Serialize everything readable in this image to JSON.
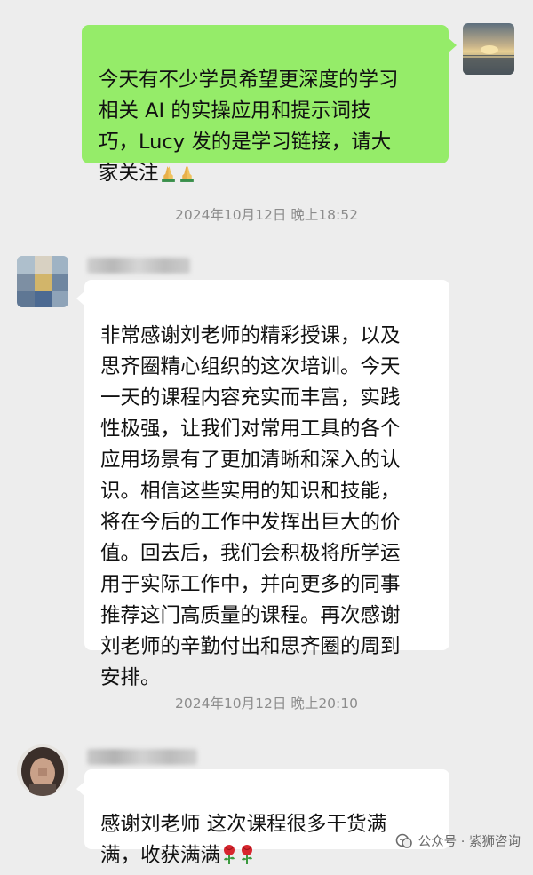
{
  "messages": [
    {
      "side": "right",
      "text": "今天有不少学员希望更深度的学习\n相关 AI 的实操应用和提示词技\n巧，Lucy 发的是学习链接，请大\n家关注",
      "emojis": [
        "praying-hands",
        "praying-hands"
      ]
    },
    {
      "side": "left",
      "text": "非常感谢刘老师的精彩授课，以及\n思齐圈精心组织的这次培训。今天\n一天的课程内容充实而丰富，实践\n性极强，让我们对常用工具的各个\n应用场景有了更加清晰和深入的认\n识。相信这些实用的知识和技能，\n将在今后的工作中发挥出巨大的价\n值。回去后，我们会积极将所学运\n用于实际工作中，并向更多的同事\n推荐这门高质量的课程。再次感谢\n刘老师的辛勤付出和思齐圈的周到\n安排。"
    },
    {
      "side": "left",
      "text": "感谢刘老师 这次课程很多干货满\n满，收获满满",
      "emojis": [
        "rose",
        "rose"
      ]
    }
  ],
  "timestamps": [
    "2024年10月12日 晚上18:52",
    "2024年10月12日 晚上20:10"
  ],
  "watermark": {
    "text": "公众号 · 紫狮咨询",
    "icon": "wechat-official-account-icon"
  },
  "colors": {
    "background": "#ededed",
    "sent_bubble": "#95ec69",
    "received_bubble": "#ffffff",
    "timestamp": "#8c8c8c"
  }
}
